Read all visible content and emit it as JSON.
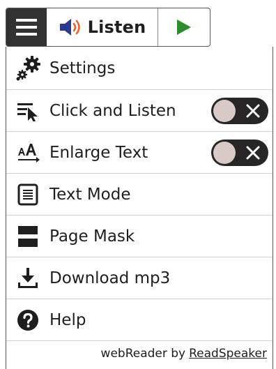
{
  "toolbar": {
    "menu_icon": "hamburger-icon",
    "listen_icon": "speaker-icon",
    "listen_label": "Listen",
    "play_icon": "play-icon"
  },
  "menu": {
    "items": [
      {
        "icon": "gears-icon",
        "label": "Settings"
      },
      {
        "icon": "click-and-listen-icon",
        "label": "Click and Listen",
        "toggle": "off"
      },
      {
        "icon": "enlarge-text-icon",
        "label": "Enlarge Text",
        "toggle": "off"
      },
      {
        "icon": "text-mode-icon",
        "label": "Text Mode"
      },
      {
        "icon": "page-mask-icon",
        "label": "Page Mask"
      },
      {
        "icon": "download-icon",
        "label": "Download mp3"
      },
      {
        "icon": "help-icon",
        "label": "Help"
      }
    ]
  },
  "footer": {
    "prefix": "webReader by",
    "brand": "ReadSpeaker"
  },
  "colors": {
    "toolbar_dark": "#323232",
    "play_green": "#2e8b2e",
    "speaker_blue": "#2b3a8f",
    "speaker_orange": "#e8632a",
    "toggle_bg": "#262626",
    "toggle_knob": "#d9c9c7"
  }
}
